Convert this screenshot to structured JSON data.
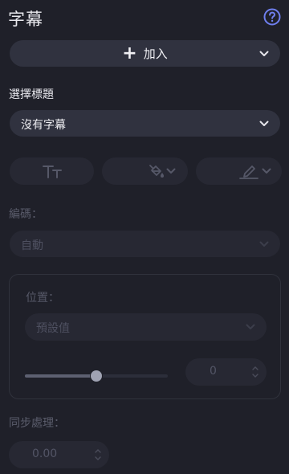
{
  "header": {
    "title": "字幕",
    "help_icon": "help-circle-icon"
  },
  "add_button": {
    "label": "加入",
    "icon": "plus-icon"
  },
  "subtitle_select": {
    "label": "選擇標題",
    "value": "沒有字幕"
  },
  "style_buttons": [
    {
      "name": "text-size-icon"
    },
    {
      "name": "paint-bucket-icon"
    },
    {
      "name": "pen-icon"
    }
  ],
  "encoding": {
    "label": "編碼：",
    "value": "自動"
  },
  "position": {
    "label": "位置：",
    "preset_value": "預設值",
    "slider_fraction": 0.5,
    "number": "0"
  },
  "sync": {
    "label": "同步處理：",
    "value": "0.00"
  },
  "colors": {
    "background": "#1f2029",
    "control_active": "#30323f",
    "control_disabled": "#272833",
    "help_accent": "#6f7fef"
  }
}
